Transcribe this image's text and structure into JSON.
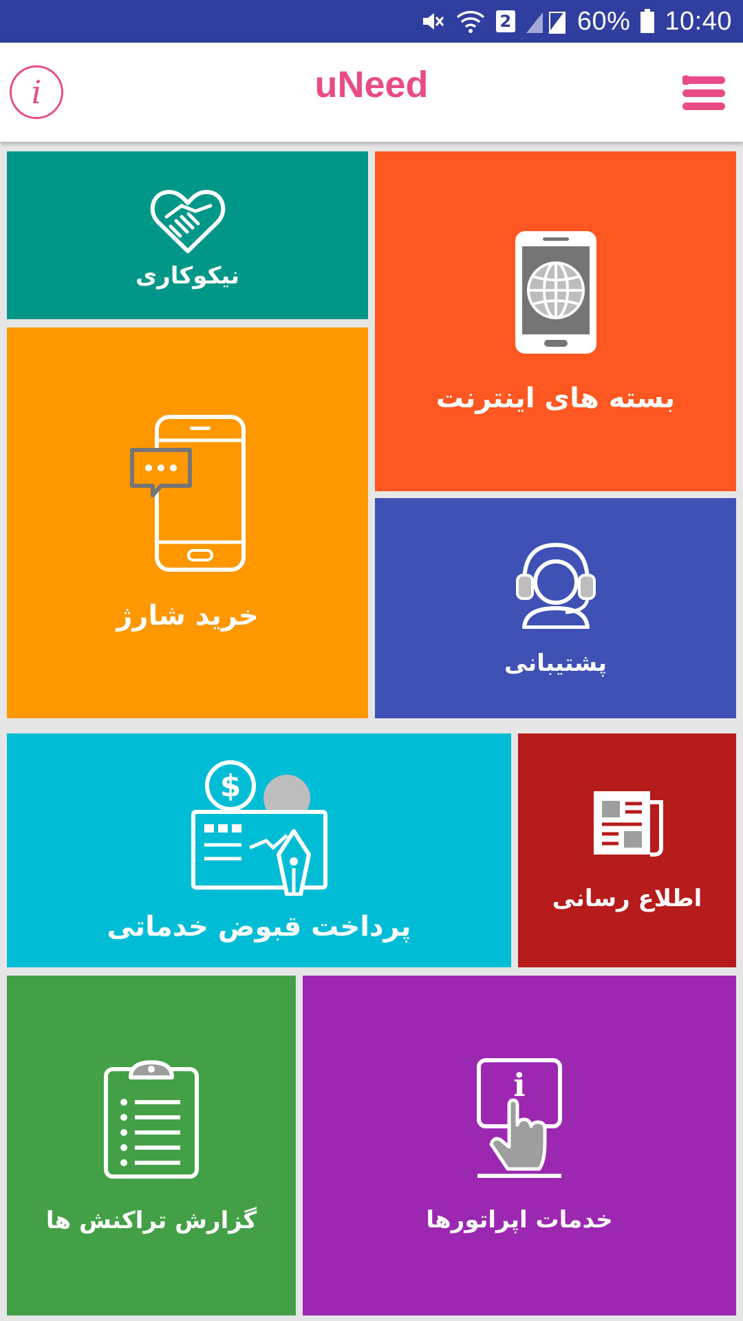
{
  "status_bar": {
    "battery": "60%",
    "time": "10:40",
    "sim_badge": "2",
    "icons": [
      "mute-icon",
      "wifi-icon",
      "signal-icon",
      "battery-icon"
    ]
  },
  "app_bar": {
    "title": "uNeed",
    "info_glyph": "i",
    "accent_color": "#e94b86"
  },
  "tiles": [
    {
      "id": "charity",
      "label": "نیکوکاری",
      "color": "#009688",
      "icon": "heart-handshake-icon"
    },
    {
      "id": "internet",
      "label": "بسته های اینترنت",
      "color": "#ff5722",
      "icon": "phone-globe-icon"
    },
    {
      "id": "charge",
      "label": "خرید شارژ",
      "color": "#ff9800",
      "icon": "phone-chat-icon"
    },
    {
      "id": "support",
      "label": "پشتیبانی",
      "color": "#3f51b5",
      "icon": "headset-agent-icon"
    },
    {
      "id": "bills",
      "label": "پرداخت قبوض خدماتی",
      "color": "#00bcd4",
      "icon": "bill-cheque-icon"
    },
    {
      "id": "news",
      "label": "اطلاع رسانی",
      "color": "#b71c1c",
      "icon": "newspaper-icon"
    },
    {
      "id": "report",
      "label": "گزارش تراکنش ها",
      "color": "#43a047",
      "icon": "clipboard-list-icon"
    },
    {
      "id": "operators",
      "label": "خدمات اپراتورها",
      "color": "#9c27b0",
      "icon": "touch-info-icon"
    }
  ]
}
